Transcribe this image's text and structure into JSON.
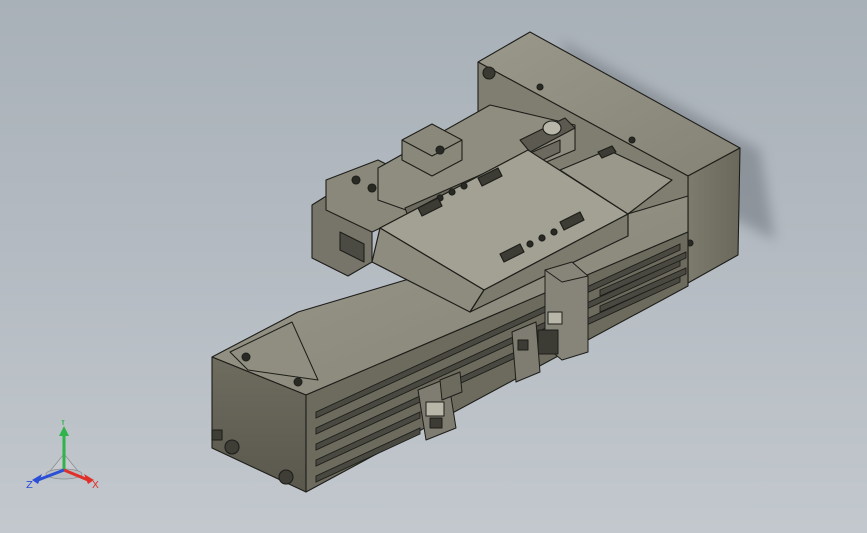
{
  "triad": {
    "x_label": "X",
    "y_label": "Y",
    "z_label": "Z",
    "x_color": "#e0302a",
    "y_color": "#2fb34a",
    "z_color": "#2a4fd6"
  },
  "colors": {
    "body_light": "#8c8a7c",
    "body_mid": "#7a7869",
    "body_dark": "#5f5d52",
    "edge": "#1e1e1a"
  }
}
